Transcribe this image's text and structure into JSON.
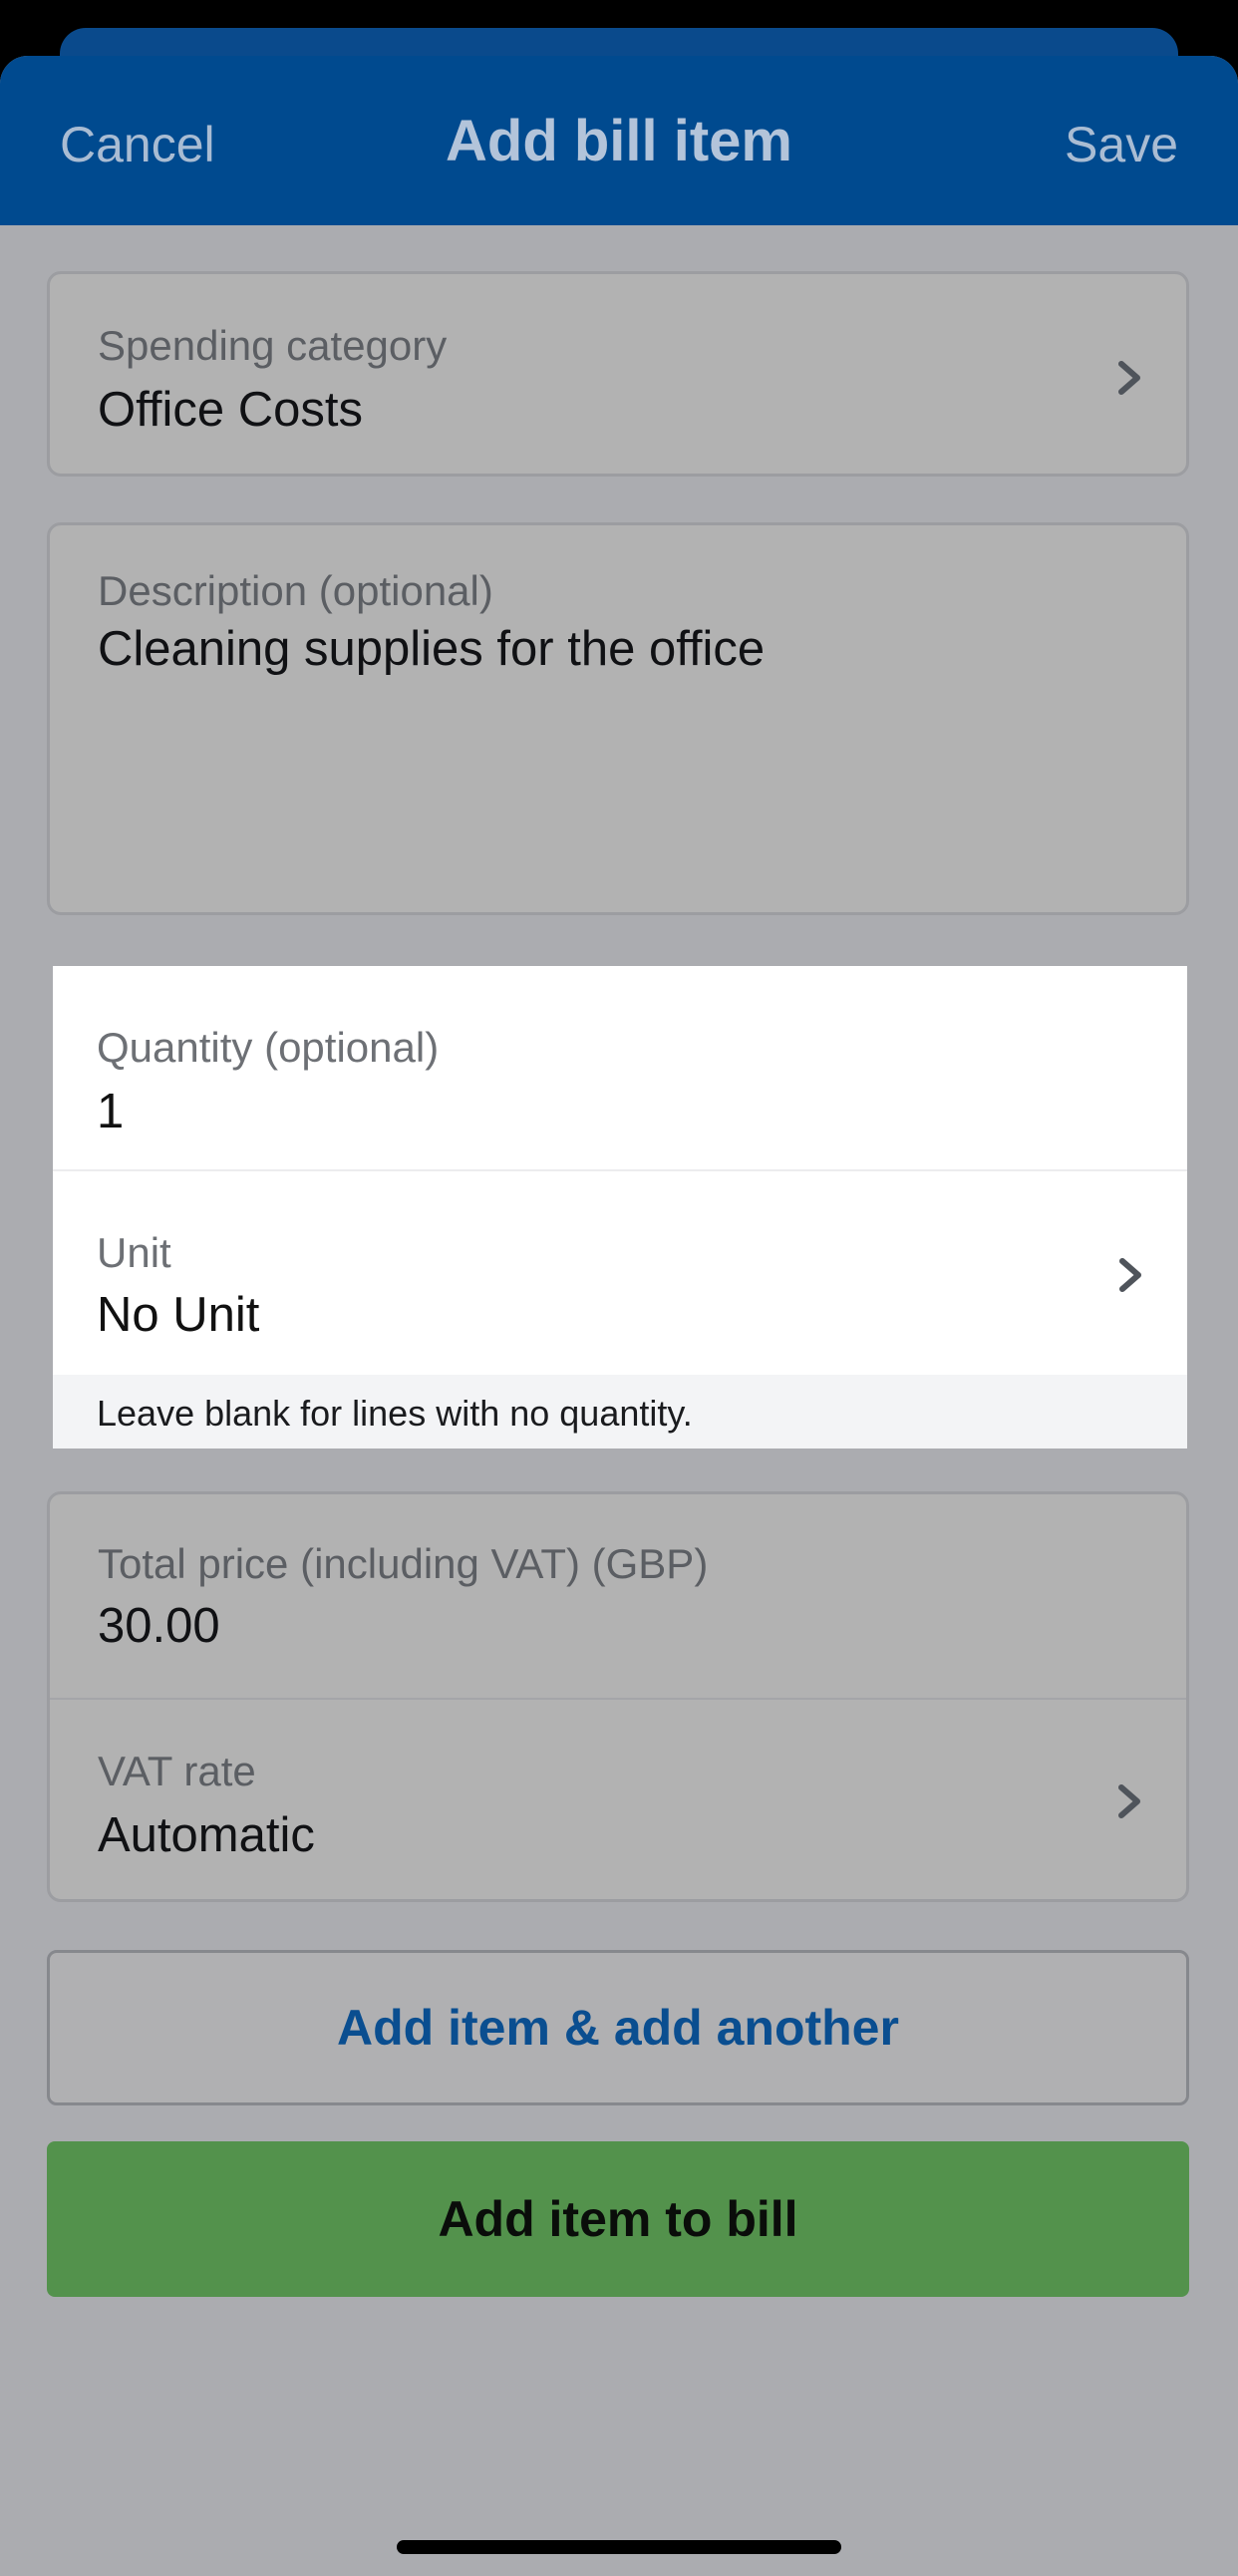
{
  "header": {
    "cancel_label": "Cancel",
    "title": "Add bill item",
    "save_label": "Save"
  },
  "category": {
    "label": "Spending category",
    "value": "Office Costs"
  },
  "description": {
    "label": "Description (optional)",
    "value": "Cleaning supplies for the office"
  },
  "quantity": {
    "label": "Quantity (optional)",
    "value": "1",
    "unit_label": "Unit",
    "unit_value": "No Unit",
    "hint": "Leave blank for lines with no quantity."
  },
  "price": {
    "label": "Total price (including VAT) (GBP)",
    "value": "30.00",
    "vat_label": "VAT rate",
    "vat_value": "Automatic"
  },
  "actions": {
    "add_another_label": "Add item & add another",
    "add_label": "Add item to bill"
  },
  "colors": {
    "brand_blue": "#004a8f",
    "primary_green": "#53924c"
  },
  "icons": {
    "chevron": "chevron-right-icon"
  }
}
